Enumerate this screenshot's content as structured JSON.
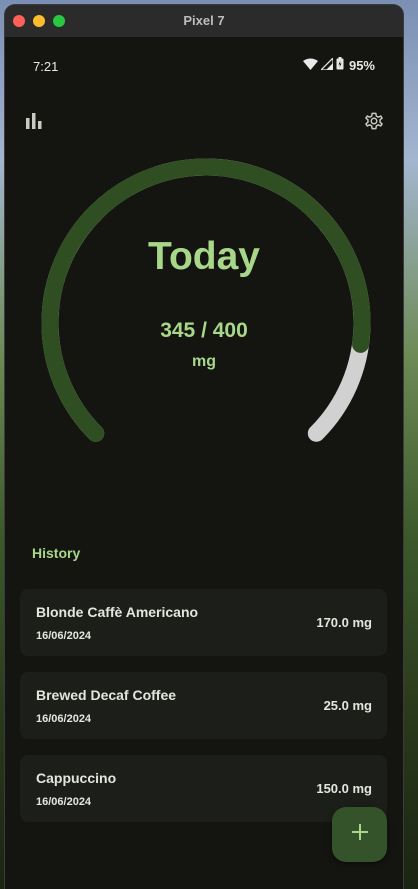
{
  "window": {
    "title": "Pixel 7"
  },
  "status_bar": {
    "time": "7:21",
    "battery": "95%"
  },
  "toolbar": {
    "stats_icon": "bar-chart-icon",
    "settings_icon": "gear-icon"
  },
  "gauge": {
    "title": "Today",
    "value_text": "345 / 400",
    "unit": "mg",
    "consumed": 345,
    "limit": 400,
    "colors": {
      "track": "#d1d1d1",
      "fill": "#2f4f22",
      "text": "#a8d78a"
    }
  },
  "history": {
    "label": "History",
    "items": [
      {
        "name": "Blonde Caffè Americano",
        "date": "16/06/2024",
        "amount": "170.0 mg"
      },
      {
        "name": "Brewed Decaf Coffee",
        "date": "16/06/2024",
        "amount": "25.0 mg"
      },
      {
        "name": "Cappuccino",
        "date": "16/06/2024",
        "amount": "150.0 mg"
      }
    ]
  },
  "fab": {
    "icon": "plus-icon",
    "symbol": "+"
  }
}
